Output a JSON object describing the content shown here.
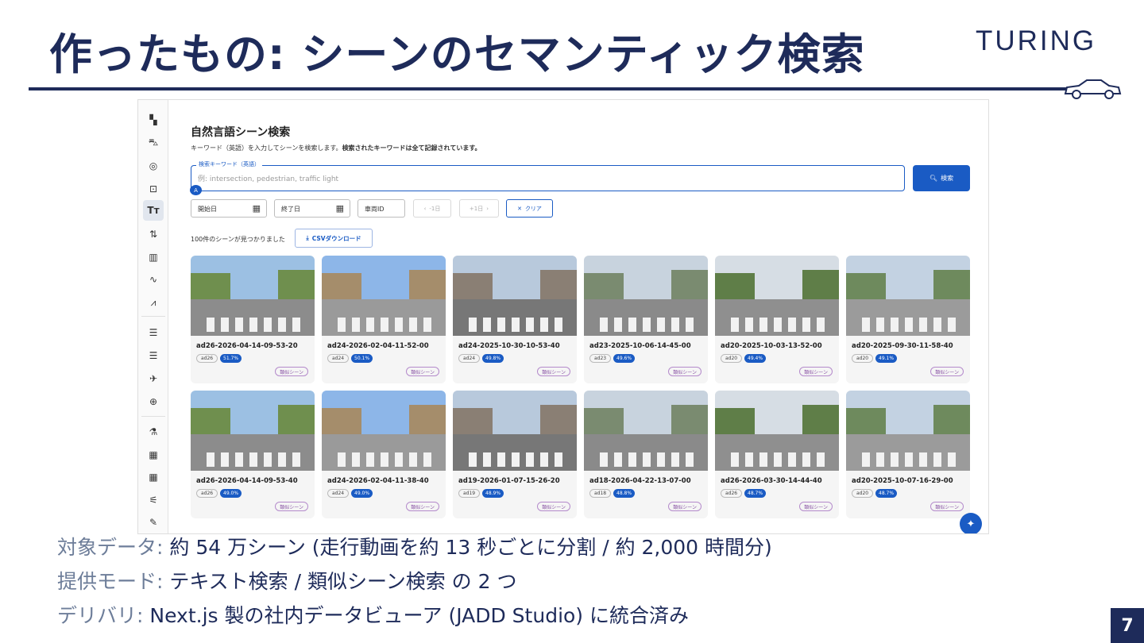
{
  "slide": {
    "title": "作ったもの: シーンのセマンティック検索",
    "logo": "TURING",
    "page_number": "7"
  },
  "app": {
    "sidebar": {
      "icons": [
        "dashboard-icon",
        "car-icon",
        "search-target-icon",
        "image-search-icon",
        "text-icon",
        "swap-icon",
        "map-icon",
        "chart-line-icon",
        "chart-search-icon",
        "list-icon",
        "list-alt-icon",
        "flight-icon",
        "add-circle-icon",
        "flask-icon",
        "bar-chart-icon",
        "grid-icon",
        "tune-icon",
        "edit-icon"
      ]
    },
    "header": {
      "title": "自然言語シーン検索",
      "description": "キーワード（英語）を入力してシーンを検索します。",
      "description_bold": "検索されたキーワードは全て記録されています。"
    },
    "search": {
      "legend": "検索キーワード（英語）",
      "placeholder": "例: intersection, pedestrian, traffic light",
      "badge": "A",
      "button_label": "検索"
    },
    "filters": {
      "start_date": "開始日",
      "end_date": "終了日",
      "vehicle_id": "車両ID",
      "prev_day": "-1日",
      "next_day": "+1日",
      "clear": "クリア"
    },
    "results": {
      "count_text": "100件のシーンが見つかりました",
      "csv_label": "CSVダウンロード"
    },
    "cards": [
      {
        "name": "ad26-2026-04-14-09-53-20",
        "vehicle": "ad26",
        "score": "51.7%",
        "tag": "類似シーン"
      },
      {
        "name": "ad24-2026-02-04-11-52-00",
        "vehicle": "ad24",
        "score": "50.1%",
        "tag": "類似シーン"
      },
      {
        "name": "ad24-2025-10-30-10-53-40",
        "vehicle": "ad24",
        "score": "49.8%",
        "tag": "類似シーン"
      },
      {
        "name": "ad23-2025-10-06-14-45-00",
        "vehicle": "ad23",
        "score": "49.6%",
        "tag": "類似シーン"
      },
      {
        "name": "ad20-2025-10-03-13-52-00",
        "vehicle": "ad20",
        "score": "49.4%",
        "tag": "類似シーン"
      },
      {
        "name": "ad20-2025-09-30-11-58-40",
        "vehicle": "ad20",
        "score": "49.1%",
        "tag": "類似シーン"
      },
      {
        "name": "ad26-2026-04-14-09-53-40",
        "vehicle": "ad26",
        "score": "49.0%",
        "tag": "類似シーン"
      },
      {
        "name": "ad24-2026-02-04-11-38-40",
        "vehicle": "ad24",
        "score": "49.0%",
        "tag": "類似シーン"
      },
      {
        "name": "ad19-2026-01-07-15-26-20",
        "vehicle": "ad19",
        "score": "48.9%",
        "tag": "類似シーン"
      },
      {
        "name": "ad18-2026-04-22-13-07-00",
        "vehicle": "ad18",
        "score": "48.8%",
        "tag": "類似シーン"
      },
      {
        "name": "ad26-2026-03-30-14-44-40",
        "vehicle": "ad26",
        "score": "48.7%",
        "tag": "類似シーン"
      },
      {
        "name": "ad20-2025-10-07-16-29-00",
        "vehicle": "ad20",
        "score": "48.7%",
        "tag": "類似シーン"
      }
    ]
  },
  "bullets": [
    {
      "label": "対象データ:",
      "value": "約 54 万シーン (走行動画を約 13 秒ごとに分割 / 約 2,000 時間分)"
    },
    {
      "label": "提供モード:",
      "value": "テキスト検索 / 類似シーン検索 の 2 つ"
    },
    {
      "label": "デリバリ:",
      "value": "Next.js 製の社内データビューア (JADD Studio) に統合済み"
    }
  ],
  "colors": {
    "navy": "#1e2b5a",
    "accent_blue": "#1a5bc4",
    "bullet_label": "#6d7d99",
    "similar_tag": "#8b56a6"
  }
}
